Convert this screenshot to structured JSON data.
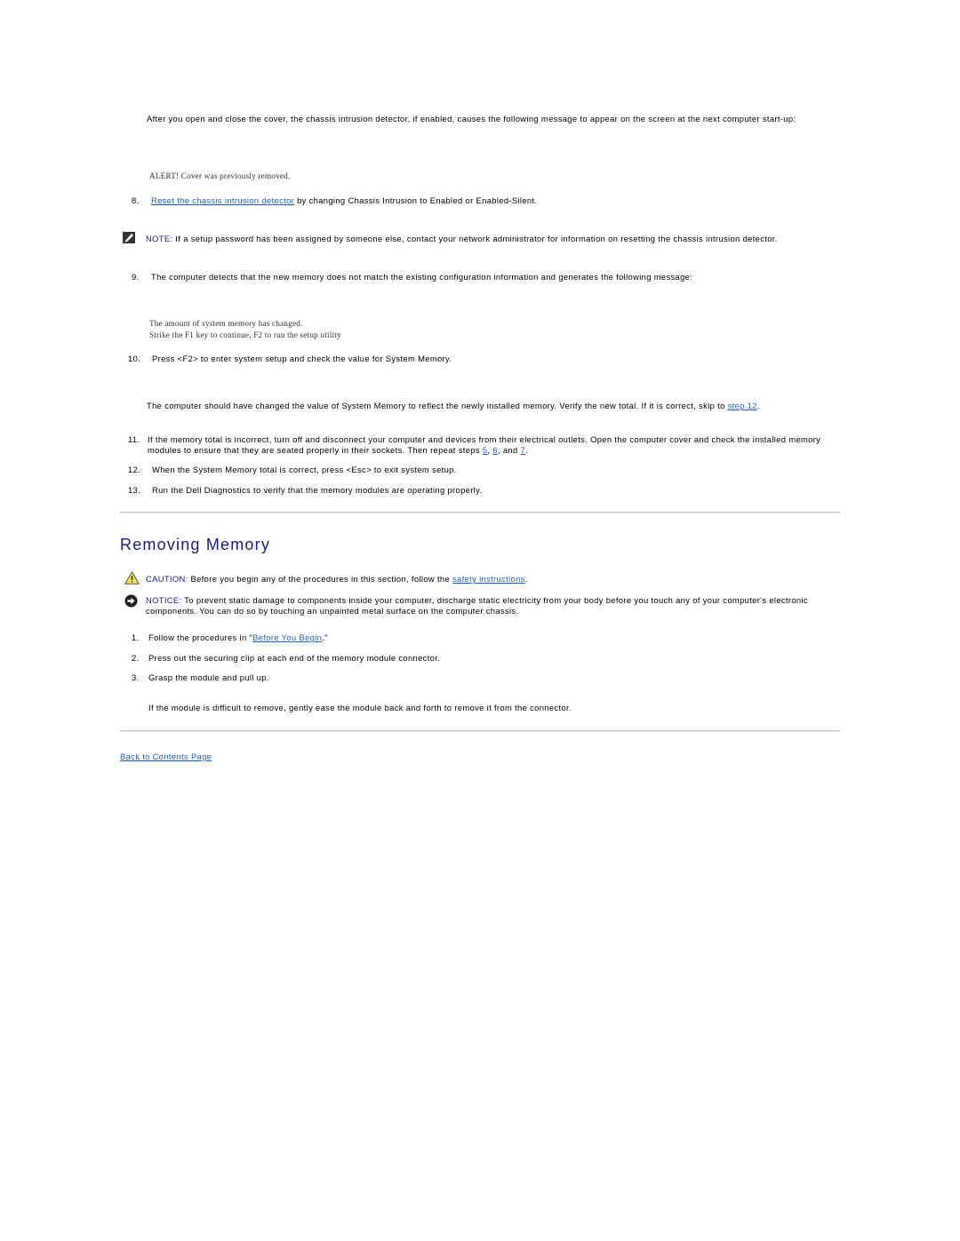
{
  "intro": {
    "text": "After you open and close the cover, the chassis intrusion detector, if enabled, causes the following message to appear on the screen at the next computer start-up:"
  },
  "alert_message": "ALERT! Cover was previously removed.",
  "steps_install": [
    {
      "num": "8.",
      "link": "Reset the chassis intrusion detector",
      "text": " by changing Chassis Intrusion to Enabled or Enabled-Silent."
    }
  ],
  "note1": {
    "icon": "note-pencil-icon",
    "label": "NOTE:",
    "text": " If a setup password has been assigned by someone else, contact your network administrator for information on resetting the chassis intrusion detector."
  },
  "step9": {
    "num": "9.",
    "text": "The computer detects that the new memory does not match the existing configuration information and generates the following message:"
  },
  "memory_message": {
    "line1": "The amount of system memory has changed.",
    "line2": "Strike the F1 key to continue, F2 to run the setup utility"
  },
  "step10": {
    "num": "10.",
    "text": "Press <F2> to enter system setup and check the value for System Memory."
  },
  "step10_detail": {
    "text": "The computer should have changed the value of System Memory to reflect the newly installed memory. Verify the new total. If it is correct, skip to ",
    "link": "step 12",
    "suffix": "."
  },
  "step11": {
    "num": "11.",
    "text": "If the memory total is incorrect, turn off and disconnect your computer and devices from their electrical outlets. Open the computer cover and check the installed memory modules to ensure that they are seated properly in their sockets. Then repeat steps ",
    "link5": "5",
    "sep1": ", ",
    "link6": "6",
    "sep2": ", and ",
    "link7": "7",
    "suffix": "."
  },
  "step12": {
    "num": "12.",
    "text": "When the System Memory total is correct, press <Esc> to exit system setup."
  },
  "step13": {
    "num": "13.",
    "text": "Run the Dell Diagnostics to verify that the memory modules are operating properly."
  },
  "removing": {
    "title": "Removing Memory",
    "caution": {
      "icon": "caution-triangle-icon",
      "label": "CAUTION:",
      "text": " Before you begin any of the procedures in this section, follow the ",
      "link": "safety instructions",
      "suffix": "."
    },
    "notice": {
      "icon": "notice-arrow-icon",
      "label": "NOTICE:",
      "text": " To prevent static damage to components inside your computer, discharge static electricity from your body before you touch any of your computer's electronic components. You can do so by touching an unpainted metal surface on the computer chassis."
    },
    "steps": [
      {
        "num": "1.",
        "text": "Follow the procedures in \"",
        "link": "Before You Begin",
        "suffix": ".\""
      },
      {
        "num": "2.",
        "text": "Press out the securing clip at each end of the memory module connector."
      },
      {
        "num": "3.",
        "text": "Grasp the module and pull up."
      }
    ],
    "step3_detail": "If the module is difficult to remove, gently ease the module back and forth to remove it from the connector."
  },
  "footer": {
    "back_link": "Back to Contents Page"
  },
  "colors": {
    "link": "#1a5fd6",
    "heading": "#1a1a9c",
    "label": "#1a1aa6"
  }
}
